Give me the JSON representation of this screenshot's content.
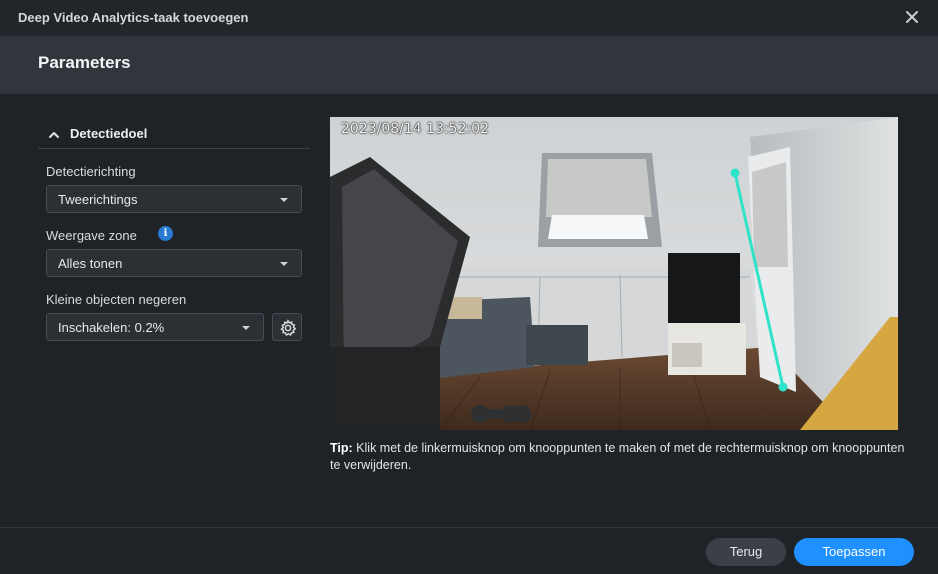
{
  "window": {
    "title": "Deep Video Analytics-taak toevoegen"
  },
  "header": {
    "title": "Parameters"
  },
  "section": {
    "title": "Detectiedoel"
  },
  "fields": {
    "direction": {
      "label": "Detectierichting",
      "value": "Tweerichtings"
    },
    "zone": {
      "label": "Weergave zone",
      "value": "Alles tonen"
    },
    "small_objects": {
      "label": "Kleine objecten negeren",
      "value": "Inschakelen: 0.2%"
    }
  },
  "preview": {
    "timestamp": "2023/08/14 13:52:02"
  },
  "tip": {
    "prefix": "Tip:",
    "text": "Klik met de linkermuisknop om knooppunten te maken of met de rechtermuisknop om knooppunten te verwijderen."
  },
  "footer": {
    "back_label": "Terug",
    "apply_label": "Toepassen"
  },
  "colors": {
    "accent": "#1e90ff",
    "line": "#2fe3c9",
    "info": "#2a7ad1"
  },
  "icons": [
    "close-icon",
    "chevron-up-icon",
    "info-icon",
    "caret-down-icon",
    "gear-icon"
  ]
}
